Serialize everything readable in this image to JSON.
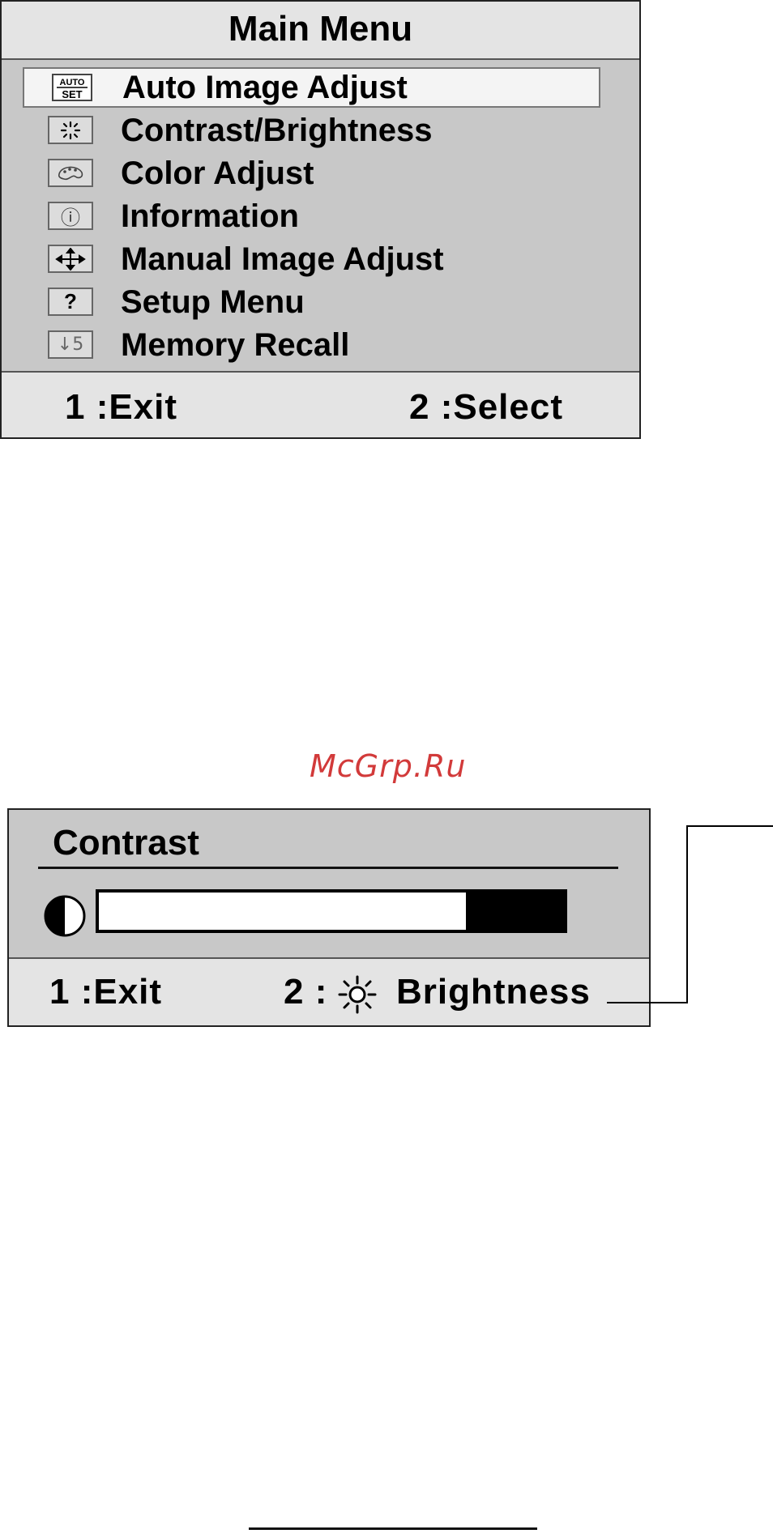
{
  "main_menu": {
    "title": "Main Menu",
    "items": [
      {
        "label": "Auto Image Adjust",
        "icon": "auto-set-icon",
        "icon_text_top": "AUTO",
        "icon_text_bottom": "SET",
        "selected": true
      },
      {
        "label": "Contrast/Brightness",
        "icon": "brightness-icon",
        "selected": false
      },
      {
        "label": "Color Adjust",
        "icon": "palette-icon",
        "selected": false
      },
      {
        "label": "Information",
        "icon": "info-icon",
        "icon_glyph": "ⓘ",
        "selected": false
      },
      {
        "label": "Manual Image Adjust",
        "icon": "move-arrows-icon",
        "selected": false
      },
      {
        "label": "Setup Menu",
        "icon": "question-icon",
        "icon_glyph": "?",
        "selected": false
      },
      {
        "label": "Memory Recall",
        "icon": "recall-icon",
        "icon_glyph": "↓5",
        "selected": false
      }
    ],
    "footer": {
      "exit": "1 :Exit",
      "select": "2 :Select"
    }
  },
  "watermark": "McGrp.Ru",
  "contrast_dialog": {
    "title": "Contrast",
    "level_fraction": 0.79,
    "footer": {
      "exit": "1 :Exit",
      "next_key": "2 :",
      "next_label": "Brightness"
    }
  },
  "colors": {
    "panel": "#c8c8c8",
    "bar_light": "#e4e4e4",
    "watermark": "#d23a3a"
  }
}
